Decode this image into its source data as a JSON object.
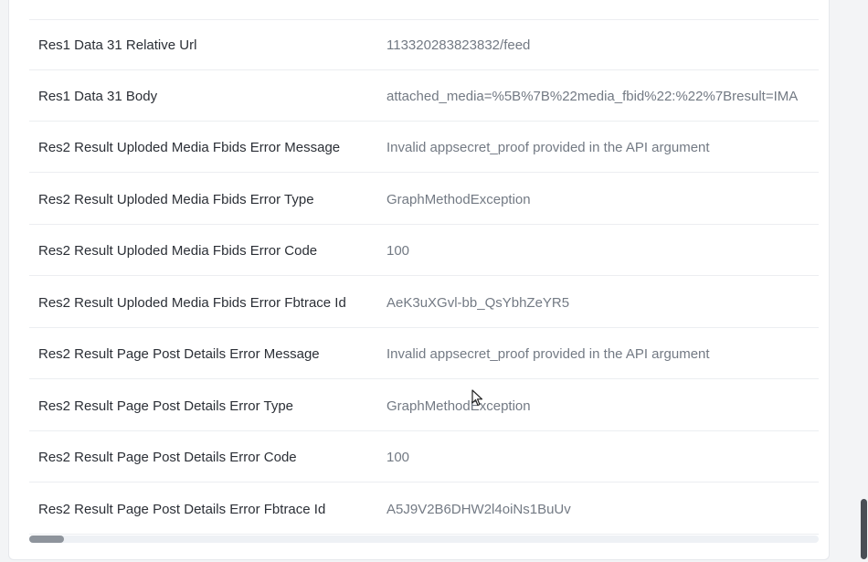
{
  "rows": [
    {
      "label": "Res1 Data 31 Relative Url",
      "value": "113320283823832/feed"
    },
    {
      "label": "Res1 Data 31 Body",
      "value": "attached_media=%5B%7B%22media_fbid%22:%22%7Bresult=IMA"
    },
    {
      "label": "Res2 Result Uploded Media Fbids Error Message",
      "value": "Invalid appsecret_proof provided in the API argument"
    },
    {
      "label": "Res2 Result Uploded Media Fbids Error Type",
      "value": "GraphMethodException"
    },
    {
      "label": "Res2 Result Uploded Media Fbids Error Code",
      "value": "100"
    },
    {
      "label": "Res2 Result Uploded Media Fbids Error Fbtrace Id",
      "value": "AeK3uXGvl-bb_QsYbhZeYR5"
    },
    {
      "label": "Res2 Result Page Post Details Error Message",
      "value": "Invalid appsecret_proof provided in the API argument"
    },
    {
      "label": "Res2 Result Page Post Details Error Type",
      "value": "GraphMethodException"
    },
    {
      "label": "Res2 Result Page Post Details Error Code",
      "value": "100"
    },
    {
      "label": "Res2 Result Page Post Details Error Fbtrace Id",
      "value": "A5J9V2B6DHW2l4oiNs1BuUv"
    }
  ],
  "icons": {
    "cursor": "mouse-pointer-icon"
  }
}
